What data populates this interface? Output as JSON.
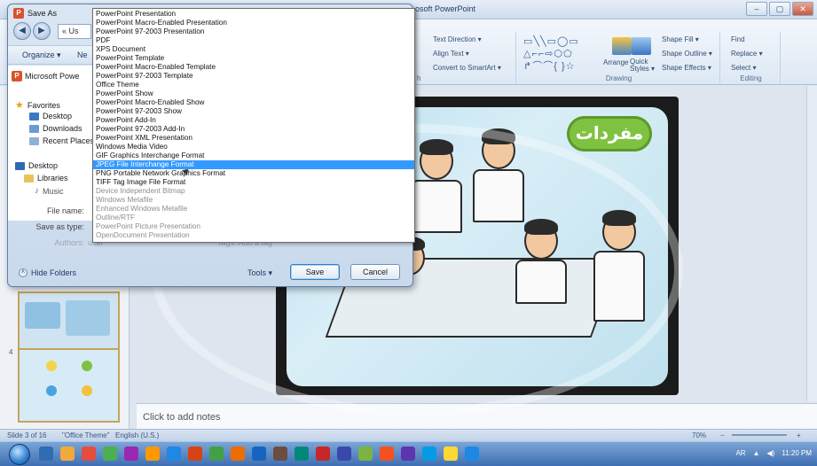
{
  "app": {
    "title": "osoft PowerPoint",
    "window_buttons": [
      "–",
      "▢",
      "✕"
    ]
  },
  "ribbon": {
    "paragraph": {
      "items": [
        "Text Direction ▾",
        "Align Text ▾",
        "Convert to SmartArt ▾"
      ]
    },
    "drawing": {
      "shapes": "▭╲╲▭◯▭\n△⌐⌐⇨⬡⬠\n↱⌒⌒{ }☆",
      "arrange": "Arrange",
      "quick_styles": "Quick Styles ▾",
      "items": [
        "Shape Fill ▾",
        "Shape Outline ▾",
        "Shape Effects ▾"
      ],
      "label": "Drawing"
    },
    "editing": {
      "items": [
        "Find",
        "Replace ▾",
        "Select ▾"
      ],
      "label": "Editing"
    },
    "para_label": "h"
  },
  "dialog": {
    "title": "Save As",
    "path": "« Us",
    "organize": "Organize ▾",
    "new_folder": "Ne",
    "presentation": "Microsoft Powe",
    "nav": [
      {
        "label": "Favorites",
        "icon": "star-icon"
      },
      {
        "label": "Desktop",
        "icon": "desktop-icon"
      },
      {
        "label": "Downloads",
        "icon": "downloads-icon"
      },
      {
        "label": "Recent Places",
        "icon": "recent-places-icon"
      },
      {
        "label": "Desktop",
        "icon": "desktop-icon"
      },
      {
        "label": "Libraries",
        "icon": "libraries-icon"
      },
      {
        "label": "Music",
        "icon": "music-icon"
      }
    ],
    "file_name_label": "File name:",
    "save_as_type_label": "Save as type:",
    "authors_label": "Authors:",
    "authors_value": "user",
    "tags": "Tags: Add a tag",
    "hide_folders": "Hide Folders",
    "tools": "Tools ▾",
    "save": "Save",
    "cancel": "Cancel",
    "file_types": [
      {
        "label": "PowerPoint Presentation",
        "state": "normal"
      },
      {
        "label": "PowerPoint Macro-Enabled Presentation",
        "state": "normal"
      },
      {
        "label": "PowerPoint 97-2003 Presentation",
        "state": "normal"
      },
      {
        "label": "PDF",
        "state": "normal"
      },
      {
        "label": "XPS Document",
        "state": "normal"
      },
      {
        "label": "PowerPoint Template",
        "state": "normal"
      },
      {
        "label": "PowerPoint Macro-Enabled Template",
        "state": "normal"
      },
      {
        "label": "PowerPoint 97-2003 Template",
        "state": "normal"
      },
      {
        "label": "Office Theme",
        "state": "normal"
      },
      {
        "label": "PowerPoint Show",
        "state": "normal"
      },
      {
        "label": "PowerPoint Macro-Enabled Show",
        "state": "normal"
      },
      {
        "label": "PowerPoint 97-2003 Show",
        "state": "normal"
      },
      {
        "label": "PowerPoint Add-In",
        "state": "normal"
      },
      {
        "label": "PowerPoint 97-2003 Add-In",
        "state": "normal"
      },
      {
        "label": "PowerPoint XML Presentation",
        "state": "normal"
      },
      {
        "label": "Windows Media Video",
        "state": "normal"
      },
      {
        "label": "GIF Graphics Interchange Format",
        "state": "normal"
      },
      {
        "label": "JPEG File Interchange Format",
        "state": "selected"
      },
      {
        "label": "PNG Portable Network Graphics Format",
        "state": "normal"
      },
      {
        "label": "TIFF Tag Image File Format",
        "state": "normal"
      },
      {
        "label": "Device Independent Bitmap",
        "state": "disabled"
      },
      {
        "label": "Windows Metafile",
        "state": "disabled"
      },
      {
        "label": "Enhanced Windows Metafile",
        "state": "disabled"
      },
      {
        "label": "Outline/RTF",
        "state": "disabled"
      },
      {
        "label": "PowerPoint Picture Presentation",
        "state": "disabled"
      },
      {
        "label": "OpenDocument Presentation",
        "state": "disabled"
      }
    ]
  },
  "thumbnails": {
    "slide_number": "4"
  },
  "slide": {
    "title": "مفردات"
  },
  "notes": {
    "placeholder": "Click to add notes"
  },
  "status": {
    "slide_info": "Slide 3 of 16",
    "theme": "\"Office Theme\"",
    "language": "English (U.S.)",
    "zoom": "70%",
    "zoom_minus": "−",
    "zoom_plus": "+"
  },
  "taskbar": {
    "lang": "AR",
    "time": "11:20 PM"
  },
  "colors": {
    "selection": "#3399ff",
    "slide_title_bg": "#7fc241",
    "thumb_border": "#c6a35b"
  }
}
